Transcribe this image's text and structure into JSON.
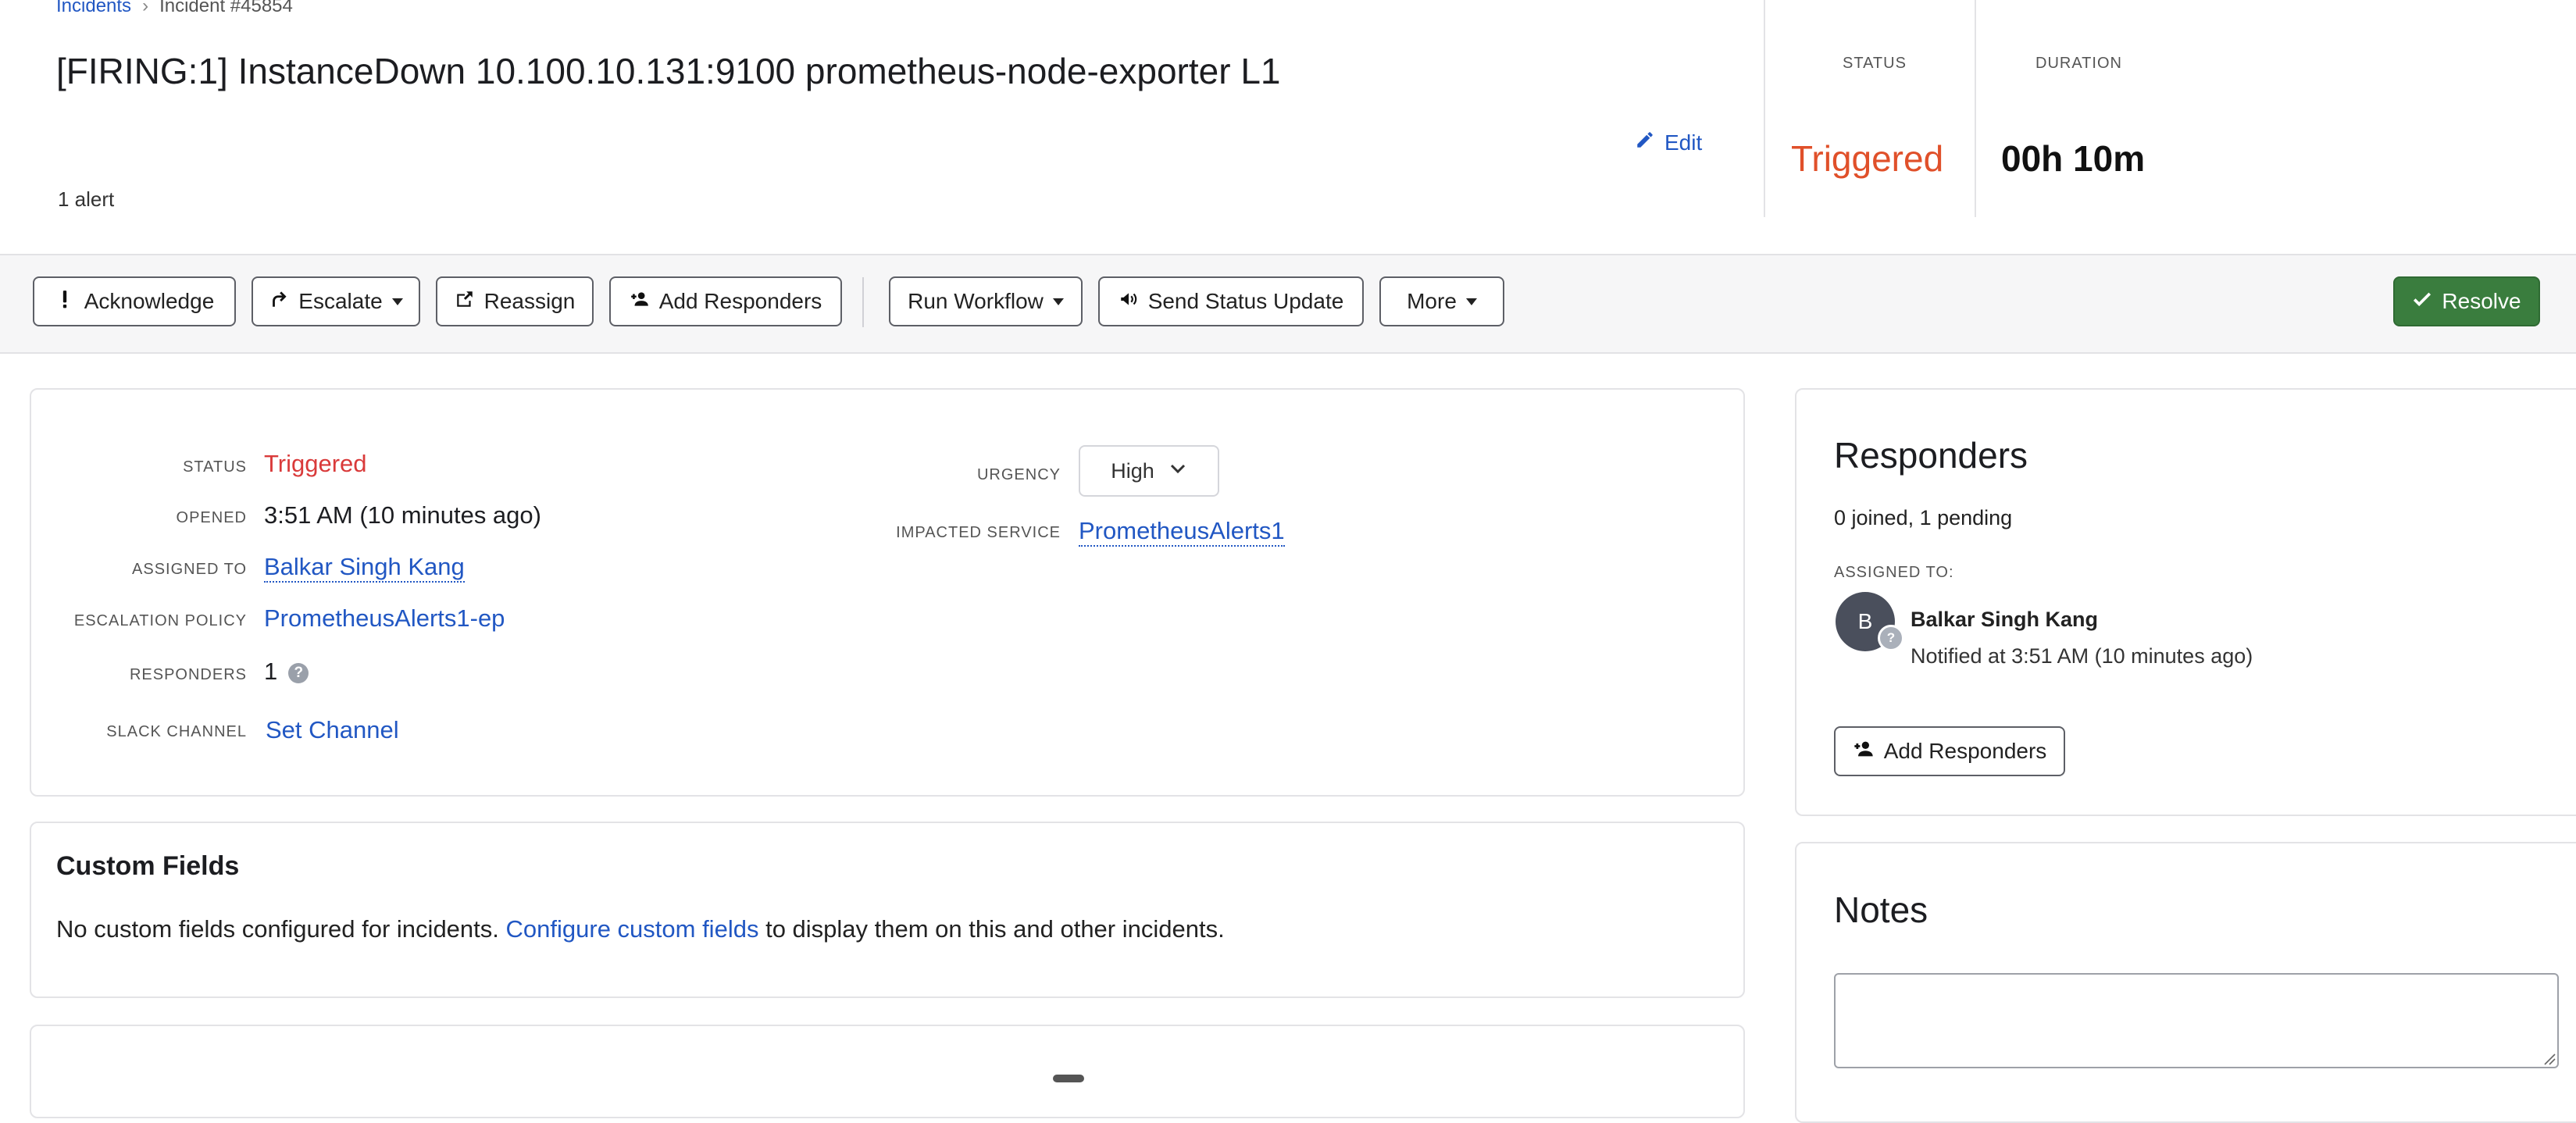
{
  "breadcrumb": {
    "root": "Incidents",
    "separator": "›",
    "current": "Incident #45854"
  },
  "incident": {
    "title": "[FIRING:1] InstanceDown 10.100.10.131:9100 prometheus-node-exporter L1",
    "alert_count": "1 alert",
    "edit_label": "Edit"
  },
  "summary": {
    "status_label": "STATUS",
    "status_value": "Triggered",
    "duration_label": "DURATION",
    "duration_value": "00h 10m"
  },
  "toolbar": {
    "acknowledge": "Acknowledge",
    "escalate": "Escalate",
    "reassign": "Reassign",
    "add_responders": "Add Responders",
    "run_workflow": "Run Workflow",
    "send_status_update": "Send Status Update",
    "more": "More",
    "resolve": "Resolve"
  },
  "details": {
    "status_label": "STATUS",
    "status_value": "Triggered",
    "opened_label": "OPENED",
    "opened_value": "3:51 AM (10 minutes ago)",
    "assigned_label": "ASSIGNED TO",
    "assigned_value": "Balkar Singh Kang",
    "escalation_label": "ESCALATION POLICY",
    "escalation_value": "PrometheusAlerts1-ep",
    "responders_label": "RESPONDERS",
    "responders_value": "1",
    "slack_label": "SLACK CHANNEL",
    "slack_value": "Set Channel",
    "urgency_label": "URGENCY",
    "urgency_value": "High",
    "service_label": "IMPACTED SERVICE",
    "service_value": "PrometheusAlerts1"
  },
  "custom_fields": {
    "title": "Custom Fields",
    "text_before": "No custom fields configured for incidents.",
    "link": "Configure custom fields",
    "text_after": "to display them on this and other incidents."
  },
  "responders_panel": {
    "title": "Responders",
    "summary": "0 joined, 1 pending",
    "assigned_label": "ASSIGNED TO:",
    "avatar_initial": "B",
    "person_name": "Balkar Singh Kang",
    "notified": "Notified at 3:51 AM (10 minutes ago)",
    "add_button": "Add Responders"
  },
  "notes": {
    "title": "Notes",
    "placeholder": ""
  },
  "colors": {
    "link": "#2157c3",
    "triggered": "#e0502a",
    "resolve_bg": "#3a7d3e"
  },
  "icons": [
    "exclamation-icon",
    "escalate-icon",
    "reassign-icon",
    "add-user-icon",
    "caret-down-icon",
    "megaphone-icon",
    "check-icon",
    "pencil-icon",
    "help-icon",
    "chevron-down-icon"
  ]
}
